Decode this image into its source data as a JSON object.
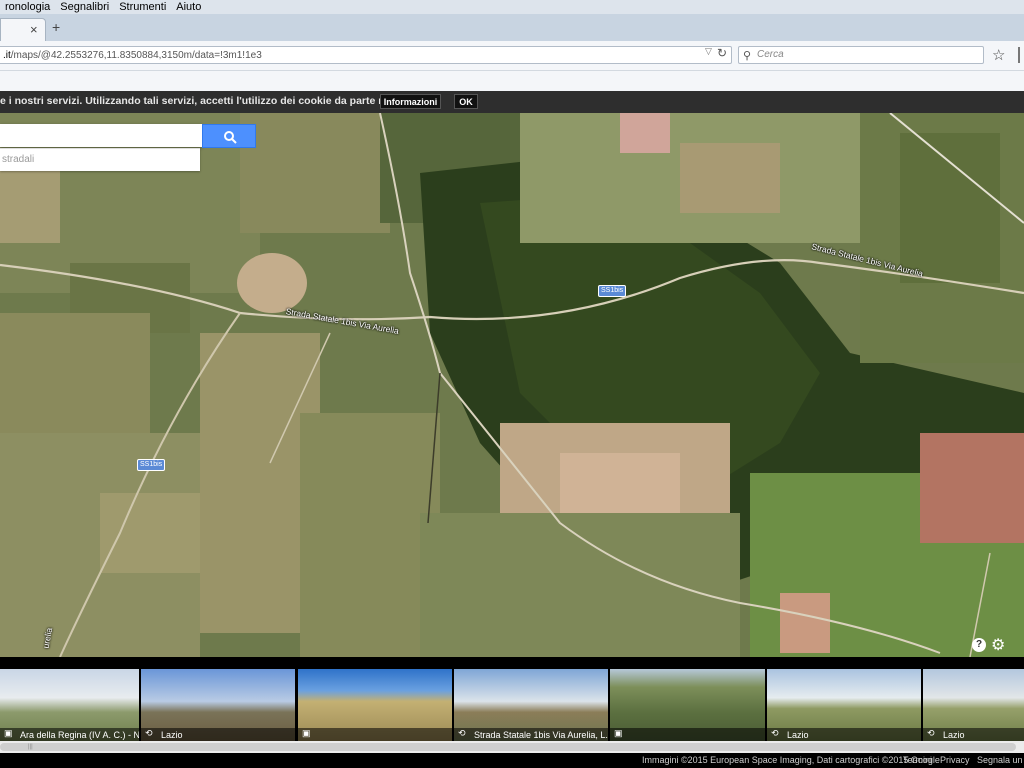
{
  "menubar": {
    "items": [
      {
        "label": "ronologia"
      },
      {
        "label": "Segnalibri"
      },
      {
        "label": "Strumenti"
      },
      {
        "label": "Aiuto"
      }
    ]
  },
  "tab": {
    "close": "×",
    "new_tab": "+"
  },
  "toolbar": {
    "url_domain": ".it",
    "url_path": "/maps/@42.2553276,11.8350884,3150m/data=!3m1!1e3",
    "search_placeholder": "Cerca"
  },
  "cookie_bar": {
    "text": "e i nostri servizi. Utilizzando tali servizi, accetti l'utilizzo dei cookie da parte nostra.",
    "info_label": "Informazioni",
    "ok_label": "OK"
  },
  "map": {
    "suggestion": "stradali",
    "labels": {
      "road_main": "Strada Statale 1bis Via Aurelia",
      "road_east": "Strada Statale 1bis Via Aurelia",
      "shield_1": "SS1bis",
      "shield_2": "SS1bis",
      "road_vertical": "urelia"
    },
    "help": "?"
  },
  "photos": [
    {
      "label": "Ara della Regina (IV A. C.) - Necr...",
      "icon": "camera-icon"
    },
    {
      "label": "Lazio",
      "icon": "panorama-icon"
    },
    {
      "label": "",
      "icon": "camera-icon"
    },
    {
      "label": "Strada Statale 1bis Via Aurelia, L...",
      "icon": "panorama-icon"
    },
    {
      "label": "",
      "icon": "camera-icon"
    },
    {
      "label": "Lazio",
      "icon": "panorama-icon"
    },
    {
      "label": "Lazio",
      "icon": "panorama-icon"
    }
  ],
  "footer": {
    "imagery": "Immagini ©2015 European Space Imaging, Dati cartografici ©2015 Google",
    "terms": "Termini",
    "privacy": "Privacy",
    "report": "Segnala un pr"
  }
}
